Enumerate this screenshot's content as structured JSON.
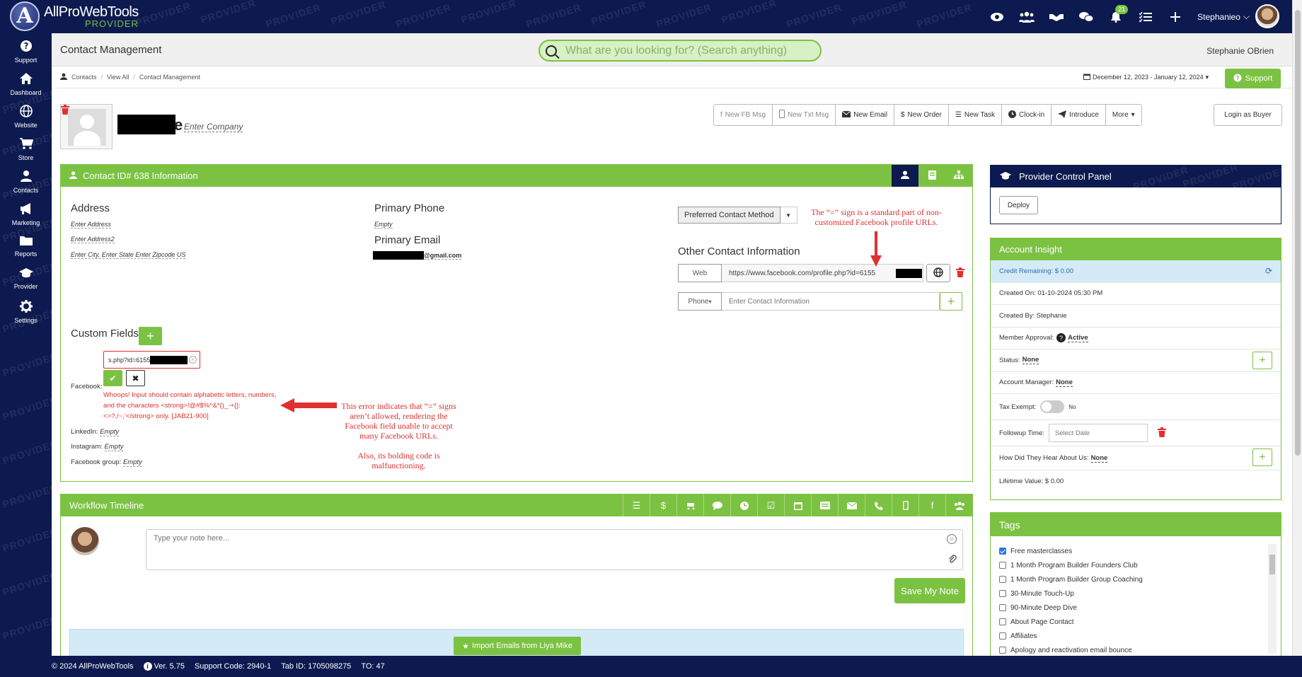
{
  "app": {
    "brand": "AllProWebTools",
    "brand_sub": "PROVIDER",
    "watermark": "PROVIDER"
  },
  "topbar": {
    "notification_count": "21",
    "user_label": "Stephanieo"
  },
  "sidebar": {
    "items": [
      {
        "label": "Support",
        "icon": "question-circle-icon"
      },
      {
        "label": "Dashboard",
        "icon": "home-icon"
      },
      {
        "label": "Website",
        "icon": "globe-icon"
      },
      {
        "label": "Store",
        "icon": "cart-icon"
      },
      {
        "label": "Contacts",
        "icon": "user-icon"
      },
      {
        "label": "Marketing",
        "icon": "bullhorn-icon"
      },
      {
        "label": "Reports",
        "icon": "folder-icon"
      },
      {
        "label": "Provider",
        "icon": "graduation-cap-icon"
      },
      {
        "label": "Settings",
        "icon": "gear-icon"
      }
    ]
  },
  "header": {
    "title": "Contact Management",
    "search_placeholder": "What are you looking for? (Search anything)",
    "user": "Stephanie OBrien"
  },
  "breadcrumb": [
    "Contacts",
    "View All",
    "Contact Management"
  ],
  "daterange": "December 12, 2023 - January 12, 2024",
  "support_button": "Support",
  "contact": {
    "name_tail": "e",
    "company_placeholder": "Enter Company"
  },
  "actions": {
    "items": [
      {
        "label": "New FB Msg",
        "disabled": true
      },
      {
        "label": "New Txt Msg",
        "disabled": true
      },
      {
        "label": "New Email",
        "disabled": false
      },
      {
        "label": "New Order",
        "disabled": false
      },
      {
        "label": "New Task",
        "disabled": false
      },
      {
        "label": "Clock-in",
        "disabled": false
      },
      {
        "label": "Introduce",
        "disabled": false
      },
      {
        "label": "More",
        "disabled": false
      }
    ],
    "login_as_buyer": "Login as Buyer"
  },
  "info_panel": {
    "title": "Contact ID# 638 Information",
    "address_label": "Address",
    "address1": "Enter Address",
    "address2": "Enter Address2",
    "city_line": "Enter City, Enter State Enter Zipcode US",
    "primary_phone_label": "Primary Phone",
    "primary_phone": "Empty",
    "primary_email_label": "Primary Email",
    "primary_email_suffix": "@gmail.com",
    "preferred_method": "Preferred Contact Method",
    "other_info_label": "Other Contact Information",
    "web_tag": "Web",
    "web_value": "https://www.facebook.com/profile.php?id=6155",
    "phone_tag": "Phone",
    "contact_placeholder": "Enter Contact Information",
    "custom_fields_label": "Custom Fields",
    "fb_input_value": "s.php?id=6155",
    "facebook_label": "Facebook:",
    "error_message": "Whoops! Input should contain alphabetic letters, numbers, and the characters <strong>!@#$%^&*()_-+{}:<>?./~,'</strong> only. [JAB21-900]",
    "linkedin_label": "LinkedIn:",
    "linkedin_value": "Empty",
    "instagram_label": "Instagram:",
    "instagram_value": "Empty",
    "fbgroup_label": "Facebook group:",
    "fbgroup_value": "Empty"
  },
  "annotations": {
    "top": "The “=” sign is a standard part of non-customized Facebook profile URLs.",
    "error_note": "This error indicates that “=” signs aren’t allowed, rendering the Facebook field unable to accept many Facebook URLs.",
    "bold_note": "Also, its bolding code is malfunctioning."
  },
  "workflow": {
    "title": "Workflow Timeline",
    "note_placeholder": "Type your note here...",
    "save_label": "Save My Note",
    "import_label": "Import Emails from Liya Mike"
  },
  "provider_panel": {
    "title": "Provider Control Panel",
    "deploy": "Deploy"
  },
  "account_insight": {
    "title": "Account Insight",
    "credit": "Credit Remaining: $ 0.00",
    "created_on": "Created On: 01-10-2024 05:30 PM",
    "created_by": "Created By: Stephanie",
    "member_approval_label": "Member Approval:",
    "member_approval_value": "Active",
    "status_label": "Status:",
    "status_value": "None",
    "manager_label": "Account Manager:",
    "manager_value": "None",
    "tax_label": "Tax Exempt:",
    "tax_value": "No",
    "followup_label": "Followup Time:",
    "followup_placeholder": "Select Date",
    "hear_label": "How Did They Hear About Us:",
    "hear_value": "None",
    "lifetime": "Lifetime Value: $ 0.00"
  },
  "tags": {
    "title": "Tags",
    "items": [
      {
        "label": "Free masterclasses",
        "checked": true
      },
      {
        "label": "1 Month Program Builder Founders Club",
        "checked": false
      },
      {
        "label": "1 Month Program Builder Group Coaching",
        "checked": false
      },
      {
        "label": "30-Minute Touch-Up",
        "checked": false
      },
      {
        "label": "90-Minute Deep Dive",
        "checked": false
      },
      {
        "label": "About Page Contact",
        "checked": false
      },
      {
        "label": "Affiliates",
        "checked": false
      },
      {
        "label": "Apology and reactivation email bounce",
        "checked": false
      }
    ]
  },
  "footer": {
    "copyright": "© 2024 AllProWebTools",
    "version": "Ver. 5.75",
    "support_code": "Support Code: 2940-1",
    "tab_id": "Tab ID: 1705098275",
    "to": "TO: 47"
  },
  "colors": {
    "navy": "#0d1a4f",
    "green": "#7cc242",
    "error_red": "#e03030",
    "light_blue": "#d5eaf7"
  }
}
